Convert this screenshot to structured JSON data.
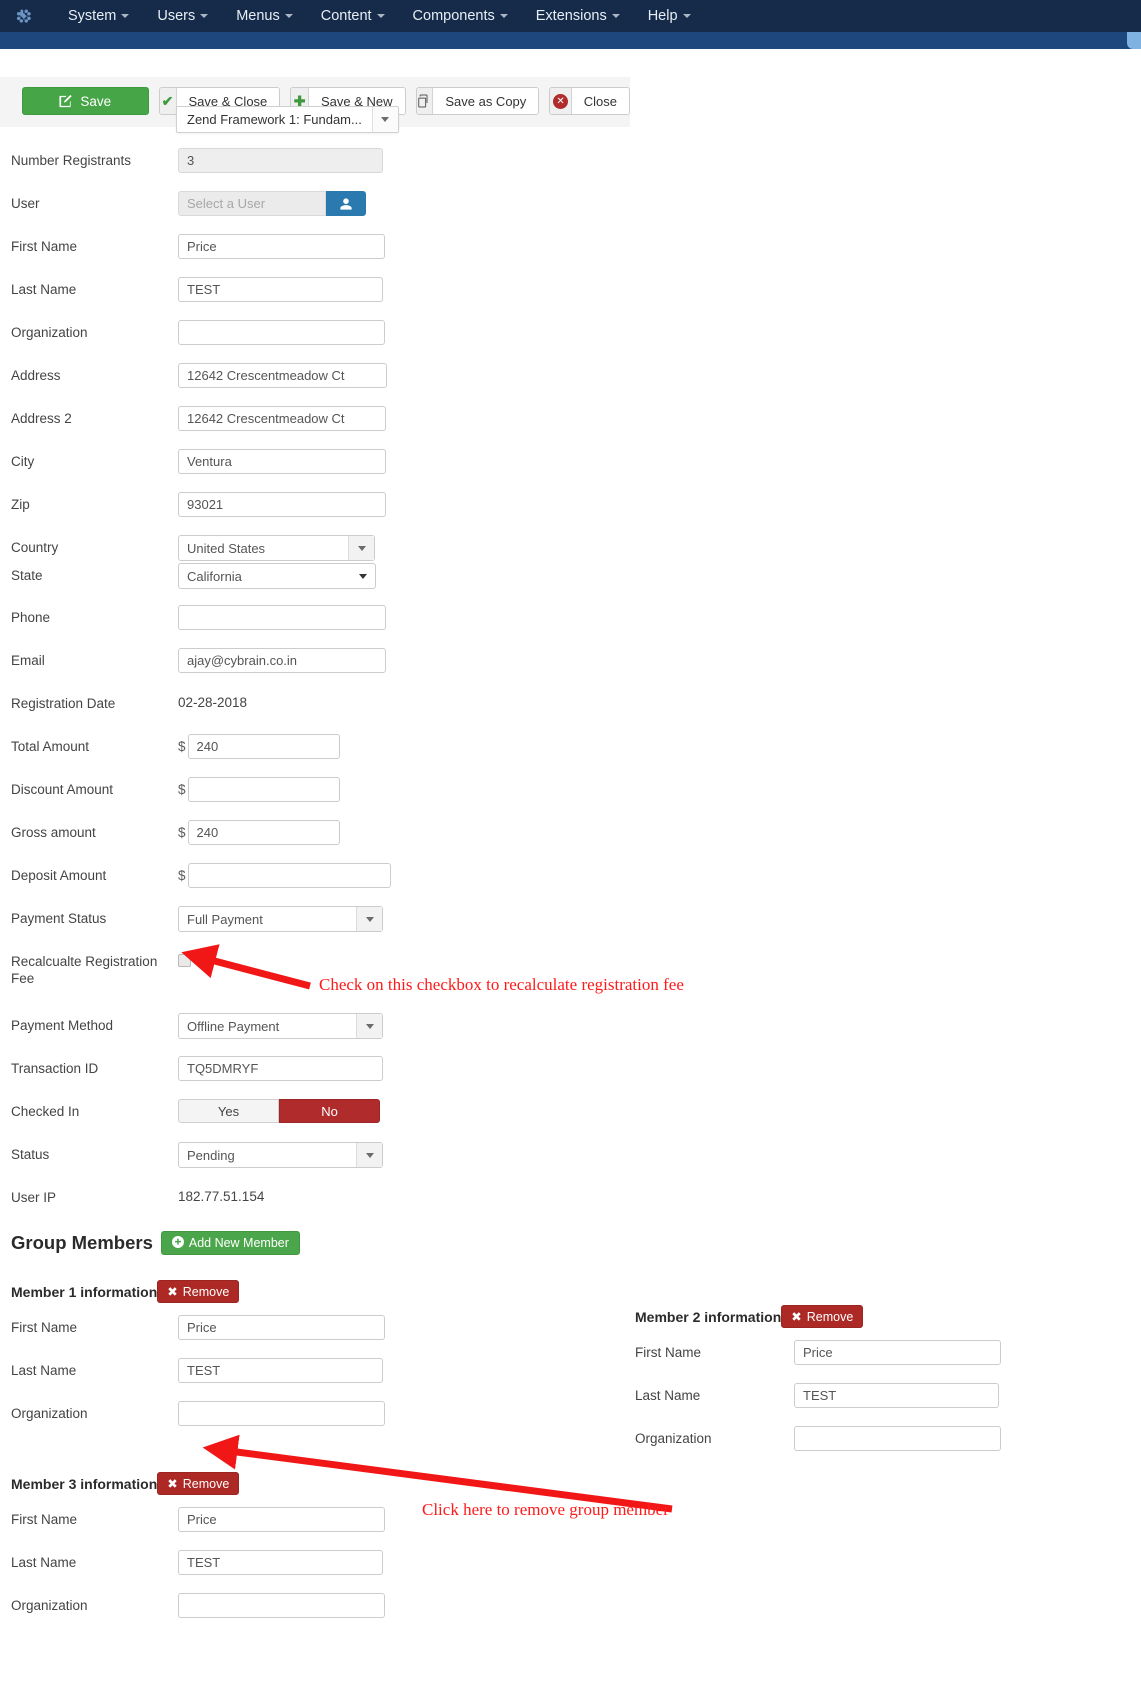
{
  "nav": {
    "logo_icon": "joomla-logo-icon",
    "items": [
      {
        "label": "System"
      },
      {
        "label": "Users"
      },
      {
        "label": "Menus"
      },
      {
        "label": "Content"
      },
      {
        "label": "Components"
      },
      {
        "label": "Extensions"
      },
      {
        "label": "Help"
      }
    ]
  },
  "toolbar": {
    "save_label": "Save",
    "save_close_label": "Save & Close",
    "save_new_label": "Save & New",
    "save_copy_label": "Save as Copy",
    "close_label": "Close"
  },
  "session": {
    "title": "Zend Framework 1: Fundam..."
  },
  "form": {
    "number_registrants": {
      "label": "Number Registrants",
      "value": "3"
    },
    "user": {
      "label": "User",
      "placeholder": "Select a User",
      "value": "",
      "button_icon": "user-icon"
    },
    "first_name": {
      "label": "First Name",
      "value": "Price"
    },
    "last_name": {
      "label": "Last Name",
      "value": "TEST"
    },
    "organization": {
      "label": "Organization",
      "value": ""
    },
    "address": {
      "label": "Address",
      "value": "12642 Crescentmeadow Ct"
    },
    "address2": {
      "label": "Address 2",
      "value": "12642 Crescentmeadow Ct"
    },
    "city": {
      "label": "City",
      "value": "Ventura"
    },
    "zip": {
      "label": "Zip",
      "value": "93021"
    },
    "country": {
      "label": "Country",
      "value": "United States"
    },
    "state": {
      "label": "State",
      "value": "California"
    },
    "phone": {
      "label": "Phone",
      "value": ""
    },
    "email": {
      "label": "Email",
      "value": "ajay@cybrain.co.in"
    },
    "registration_date": {
      "label": "Registration Date",
      "value": "02-28-2018"
    },
    "total_amount": {
      "label": "Total Amount",
      "currency": "$",
      "value": "240"
    },
    "discount_amount": {
      "label": "Discount Amount",
      "currency": "$",
      "value": ""
    },
    "gross_amount": {
      "label": "Gross amount",
      "currency": "$",
      "value": "240"
    },
    "deposit_amount": {
      "label": "Deposit Amount",
      "currency": "$",
      "value": ""
    },
    "payment_status": {
      "label": "Payment Status",
      "value": "Full Payment"
    },
    "recalculate_fee": {
      "label": "Recalcualte Registration Fee",
      "checked": false
    },
    "payment_method": {
      "label": "Payment Method",
      "value": "Offline Payment"
    },
    "transaction_id": {
      "label": "Transaction ID",
      "value": "TQ5DMRYF"
    },
    "checked_in": {
      "label": "Checked In",
      "yes_label": "Yes",
      "no_label": "No",
      "selected": "No"
    },
    "status": {
      "label": "Status",
      "value": "Pending"
    },
    "user_ip": {
      "label": "User IP",
      "value": "182.77.51.154"
    }
  },
  "group_members": {
    "title": "Group Members",
    "add_label": "Add New Member",
    "remove_label": "Remove",
    "field_labels": {
      "first_name": "First Name",
      "last_name": "Last Name",
      "organization": "Organization"
    },
    "members": [
      {
        "heading": "Member 1 information",
        "first_name": "Price",
        "last_name": "TEST",
        "organization": ""
      },
      {
        "heading": "Member 2 information",
        "first_name": "Price",
        "last_name": "TEST",
        "organization": ""
      },
      {
        "heading": "Member 3 information",
        "first_name": "Price",
        "last_name": "TEST",
        "organization": ""
      }
    ]
  },
  "annotations": {
    "checkbox_note": "Check on this checkbox to recalculate registration fee",
    "remove_note": "Click here to remove group member",
    "color": "#ff1a1a"
  }
}
